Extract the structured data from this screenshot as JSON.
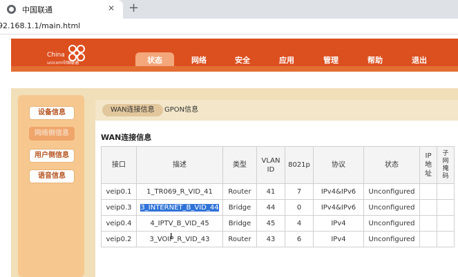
{
  "browser": {
    "tab_title": "中国联通",
    "close_glyph": "✕",
    "new_tab_glyph": "+",
    "url": "92.168.1.1/main.html"
  },
  "logo": {
    "text_en": "China",
    "text_sub": "unicom中国联通"
  },
  "nav": {
    "items": [
      {
        "label": "状态",
        "active": true
      },
      {
        "label": "网络"
      },
      {
        "label": "安全"
      },
      {
        "label": "应用"
      },
      {
        "label": "管理"
      },
      {
        "label": "帮助"
      },
      {
        "label": "退出"
      }
    ]
  },
  "sidebar": {
    "items": [
      {
        "label": "设备信息"
      },
      {
        "label": "网络侧信息",
        "active": true
      },
      {
        "label": "用户侧信息"
      },
      {
        "label": "语音信息"
      }
    ]
  },
  "subtabs": [
    {
      "label": "WAN连接信息",
      "active": true
    },
    {
      "label": "GPON信息"
    }
  ],
  "section_title": "WAN连接信息",
  "table": {
    "headers": [
      "接口",
      "描述",
      "类型",
      "VLAN\nID",
      "8021p",
      "协议",
      "状态",
      "IP\n地\n址",
      "子\n网\n掩\n码"
    ],
    "rows": [
      [
        "veip0.1",
        "1_TR069_R_VID_41",
        "Router",
        "41",
        "7",
        "IPv4&IPv6",
        "Unconfigured",
        "",
        ""
      ],
      [
        "veip0.3",
        "3_INTERNET_B_VID_44",
        "Bridge",
        "44",
        "0",
        "IPv4&IPv6",
        "Unconfigured",
        "",
        ""
      ],
      [
        "veip0.4",
        "4_IPTV_B_VID_45",
        "Bridge",
        "45",
        "4",
        "IPv4",
        "Unconfigured",
        "",
        ""
      ],
      [
        "veip0.2",
        "3_VOIP_R_VID_43",
        "Router",
        "43",
        "6",
        "IPv4",
        "Unconfigured",
        "",
        ""
      ]
    ]
  },
  "colors": {
    "header": "#dc4f1f",
    "highlight": "#2f73d8",
    "sidebar": "#f6c88f"
  }
}
